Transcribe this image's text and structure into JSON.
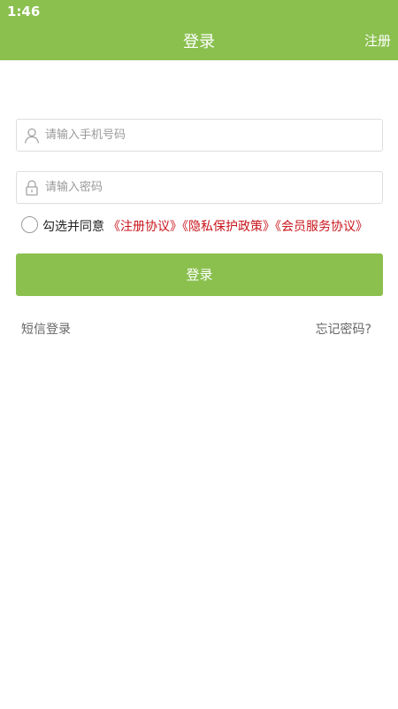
{
  "status_bar": {
    "time": "1:46"
  },
  "header": {
    "title": "登录",
    "register_label": "注册"
  },
  "form": {
    "phone_placeholder": "请输入手机号码",
    "password_placeholder": "请输入密码",
    "agree_text": "勾选并同意",
    "links": [
      "《注册协议》",
      "《隐私保护政策》",
      "《会员服务协议》"
    ],
    "login_label": "登录"
  },
  "footer_links": {
    "sms_login": "短信登录",
    "forgot_password": "忘记密码?"
  },
  "colors": {
    "brand_green": "#8bc04f",
    "link_red": "#c8161d"
  },
  "icons": {
    "phone_field": "user-icon",
    "password_field": "lock-icon"
  }
}
